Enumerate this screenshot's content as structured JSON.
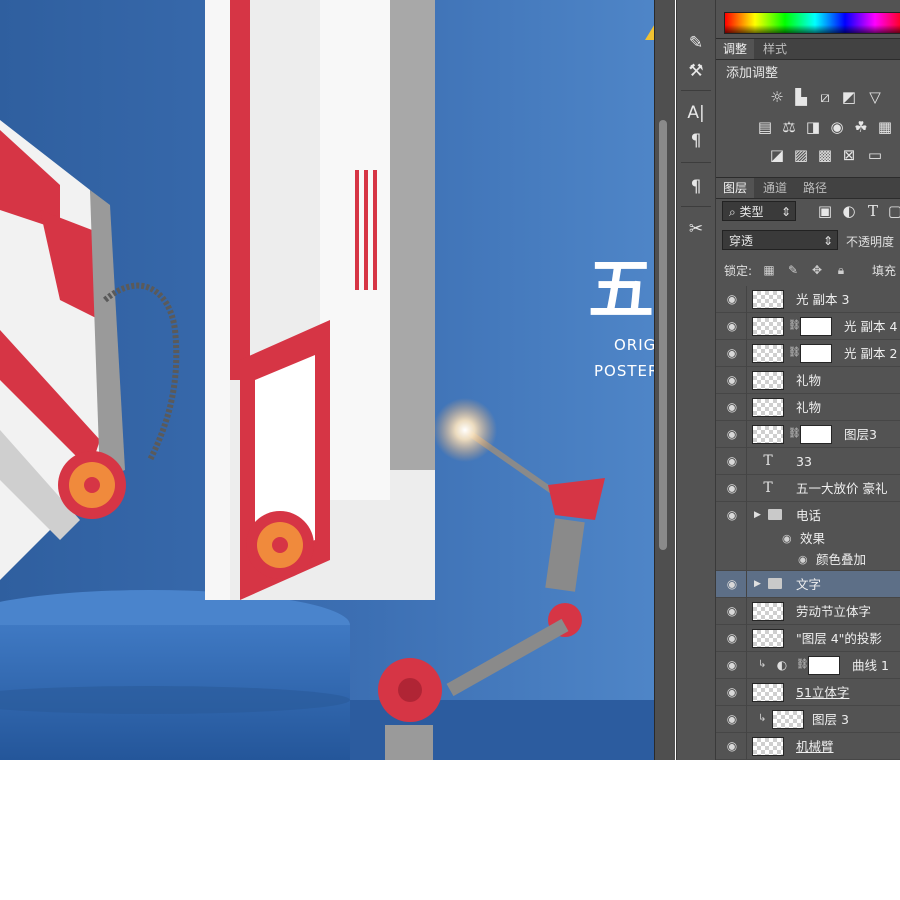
{
  "poster": {
    "title": "五",
    "line1": "ORIG",
    "line2": "POSTER"
  },
  "adjustments_panel": {
    "tabs": [
      "调整",
      "样式"
    ],
    "title": "添加调整"
  },
  "layers_panel": {
    "tabs": [
      "图层",
      "通道",
      "路径"
    ],
    "filter_kind": "类型",
    "blend_mode": "穿透",
    "opacity_label": "不透明度",
    "lock_label": "锁定:",
    "fill_label": "填充"
  },
  "layers": [
    {
      "name": "光 副本 3",
      "kind": "pixel",
      "mask": false
    },
    {
      "name": "光 副本 4",
      "kind": "pixel",
      "mask": true
    },
    {
      "name": "光 副本 2",
      "kind": "pixel",
      "mask": true
    },
    {
      "name": "礼物",
      "kind": "pixel",
      "mask": false
    },
    {
      "name": "礼物",
      "kind": "pixel",
      "mask": false
    },
    {
      "name": "图层3",
      "kind": "pixel",
      "mask": true
    },
    {
      "name": "33",
      "kind": "text"
    },
    {
      "name": "五一大放价  豪礼",
      "kind": "text"
    },
    {
      "name": "电话",
      "kind": "group"
    },
    {
      "name": "效果",
      "kind": "effects"
    },
    {
      "name": "颜色叠加",
      "kind": "effect"
    },
    {
      "name": "文字",
      "kind": "group",
      "selected": true
    },
    {
      "name": "劳动节立体字",
      "kind": "pixel"
    },
    {
      "name": "\"图层 4\"的投影",
      "kind": "pixel"
    },
    {
      "name": "曲线 1",
      "kind": "adjustment"
    },
    {
      "name": "51立体字",
      "kind": "pixel"
    },
    {
      "name": "图层 3",
      "kind": "pixel",
      "clipped": true
    },
    {
      "name": "机械臂",
      "kind": "pixel"
    }
  ],
  "colors": {
    "poster_blue": "#3f70b4",
    "robot_red": "#d63545",
    "panel_gray": "#535353",
    "selected_layer": "#5d6f87"
  },
  "icons": [
    "eye-icon",
    "link-icon",
    "folder-icon",
    "text-layer-icon",
    "brush-tool-icon",
    "type-tool-icon",
    "paragraph-icon",
    "scissors-icon",
    "lock-icon"
  ]
}
